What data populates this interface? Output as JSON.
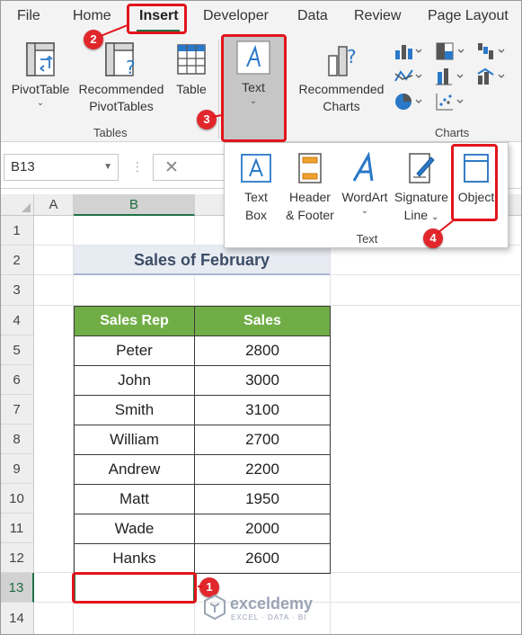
{
  "menu": {
    "tabs": [
      "File",
      "Home",
      "Insert",
      "Developer",
      "Data",
      "Review",
      "Page Layout"
    ],
    "active": "Insert"
  },
  "ribbon": {
    "tables_group": {
      "label": "Tables",
      "pivottable": "PivotTable",
      "recommended_pivottables_1": "Recommended",
      "recommended_pivottables_2": "PivotTables",
      "table": "Table"
    },
    "text_button": "Text",
    "recommended_charts_1": "Recommended",
    "recommended_charts_2": "Charts",
    "charts_group_label": "Charts"
  },
  "formula_bar": {
    "name_box": "B13"
  },
  "text_dropdown": {
    "label": "Text",
    "items": {
      "text_box_1": "Text",
      "text_box_2": "Box",
      "header_footer_1": "Header",
      "header_footer_2": "& Footer",
      "wordart": "WordArt",
      "signature_line_1": "Signature",
      "signature_line_2": "Line",
      "object": "Object"
    }
  },
  "sheet": {
    "columns": [
      "A",
      "B"
    ],
    "rows": [
      "1",
      "2",
      "3",
      "4",
      "5",
      "6",
      "7",
      "8",
      "9",
      "10",
      "11",
      "12",
      "13",
      "14"
    ],
    "title": "Sales of February",
    "headers": [
      "Sales Rep",
      "Sales"
    ],
    "data": [
      [
        "Peter",
        "2800"
      ],
      [
        "John",
        "3000"
      ],
      [
        "Smith",
        "3100"
      ],
      [
        "William",
        "2700"
      ],
      [
        "Andrew",
        "2200"
      ],
      [
        "Matt",
        "1950"
      ],
      [
        "Wade",
        "2000"
      ],
      [
        "Hanks",
        "2600"
      ]
    ],
    "selected_cell": "B13"
  },
  "annotations": {
    "step1": "1",
    "step2": "2",
    "step3": "3",
    "step4": "4"
  },
  "watermark": {
    "name": "exceldemy",
    "tagline": "EXCEL · DATA · BI"
  },
  "colors": {
    "excel_green": "#217346",
    "header_green": "#70ad47",
    "annotation_red": "#e1141c"
  }
}
